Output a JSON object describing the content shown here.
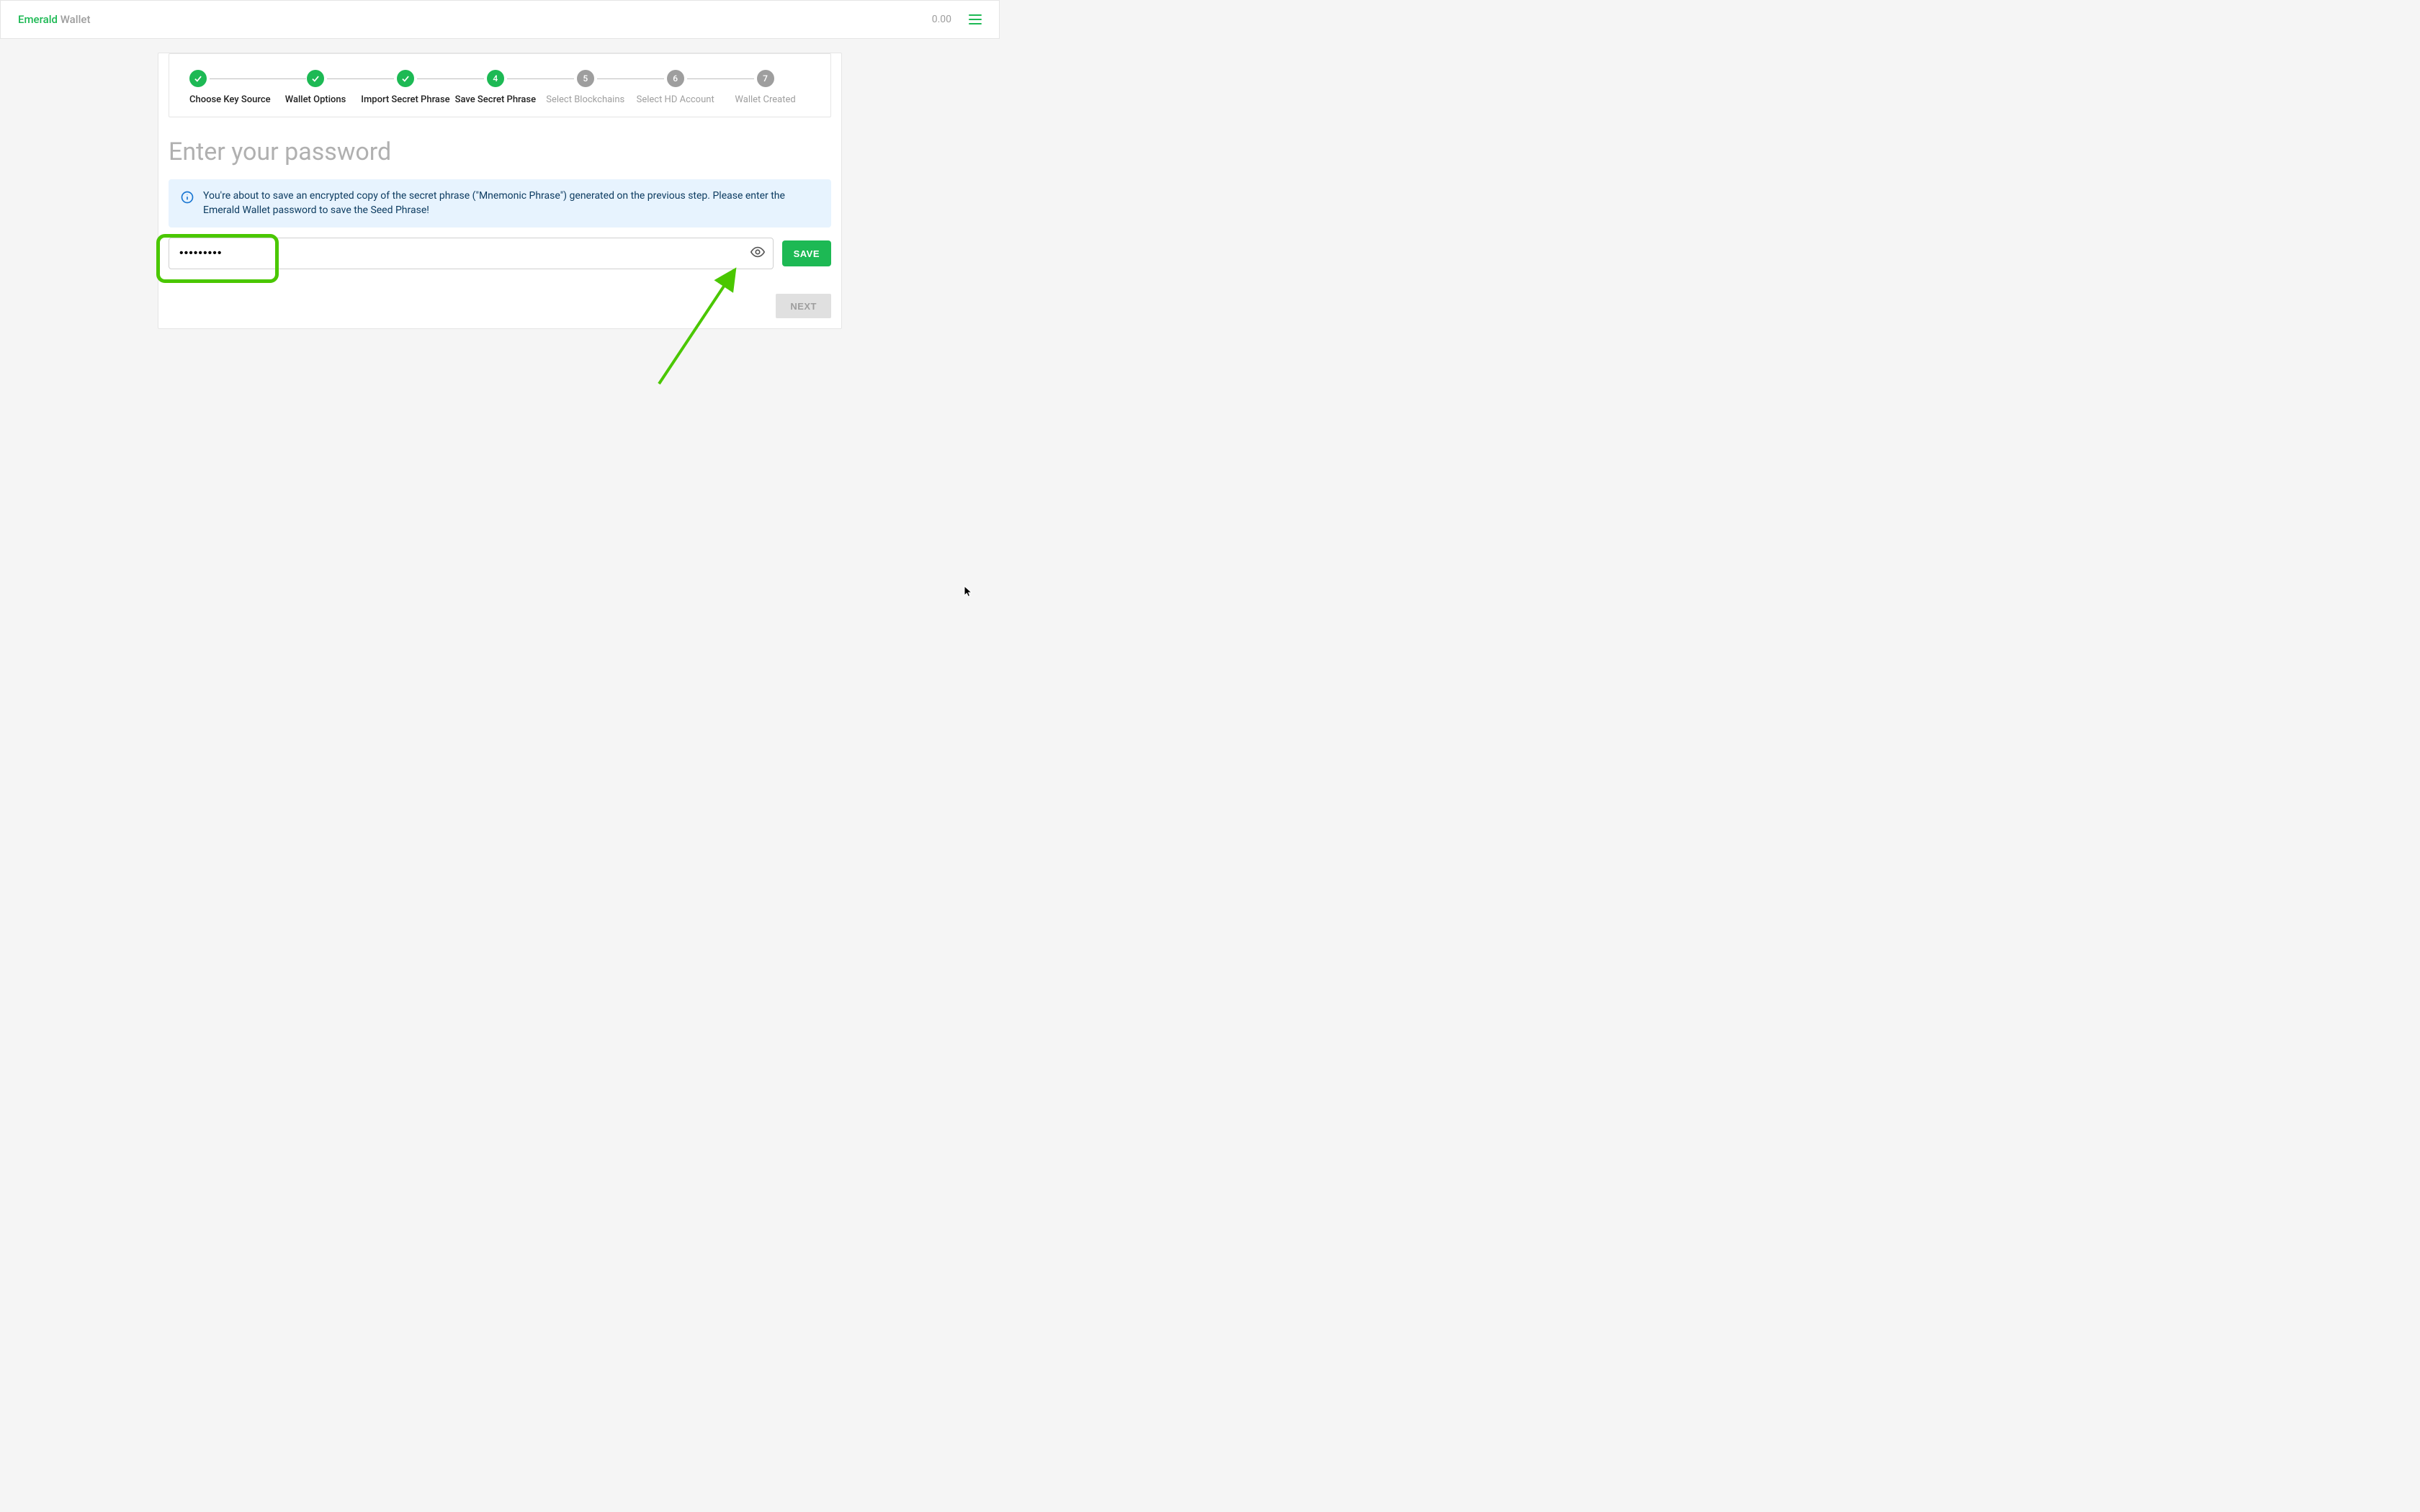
{
  "header": {
    "brand_primary": "Emerald",
    "brand_secondary": " Wallet",
    "balance": "0.00"
  },
  "stepper": {
    "steps": [
      {
        "label": "Choose Key Source",
        "state": "done",
        "badge": "check"
      },
      {
        "label": "Wallet Options",
        "state": "done",
        "badge": "check"
      },
      {
        "label": "Import Secret Phrase",
        "state": "done",
        "badge": "check"
      },
      {
        "label": "Save Secret Phrase",
        "state": "active",
        "badge": "4"
      },
      {
        "label": "Select Blockchains",
        "state": "pending",
        "badge": "5"
      },
      {
        "label": "Select HD Account",
        "state": "pending",
        "badge": "6"
      },
      {
        "label": "Wallet Created",
        "state": "pending",
        "badge": "7"
      }
    ]
  },
  "page": {
    "title": "Enter your password",
    "alert": "You're about to save an encrypted copy of the secret phrase (\"Mnemonic Phrase\") generated on the previous step. Please enter the Emerald Wallet password to save the Seed Phrase!"
  },
  "form": {
    "password_value": "•••••••••",
    "save_label": "SAVE",
    "next_label": "NEXT"
  }
}
